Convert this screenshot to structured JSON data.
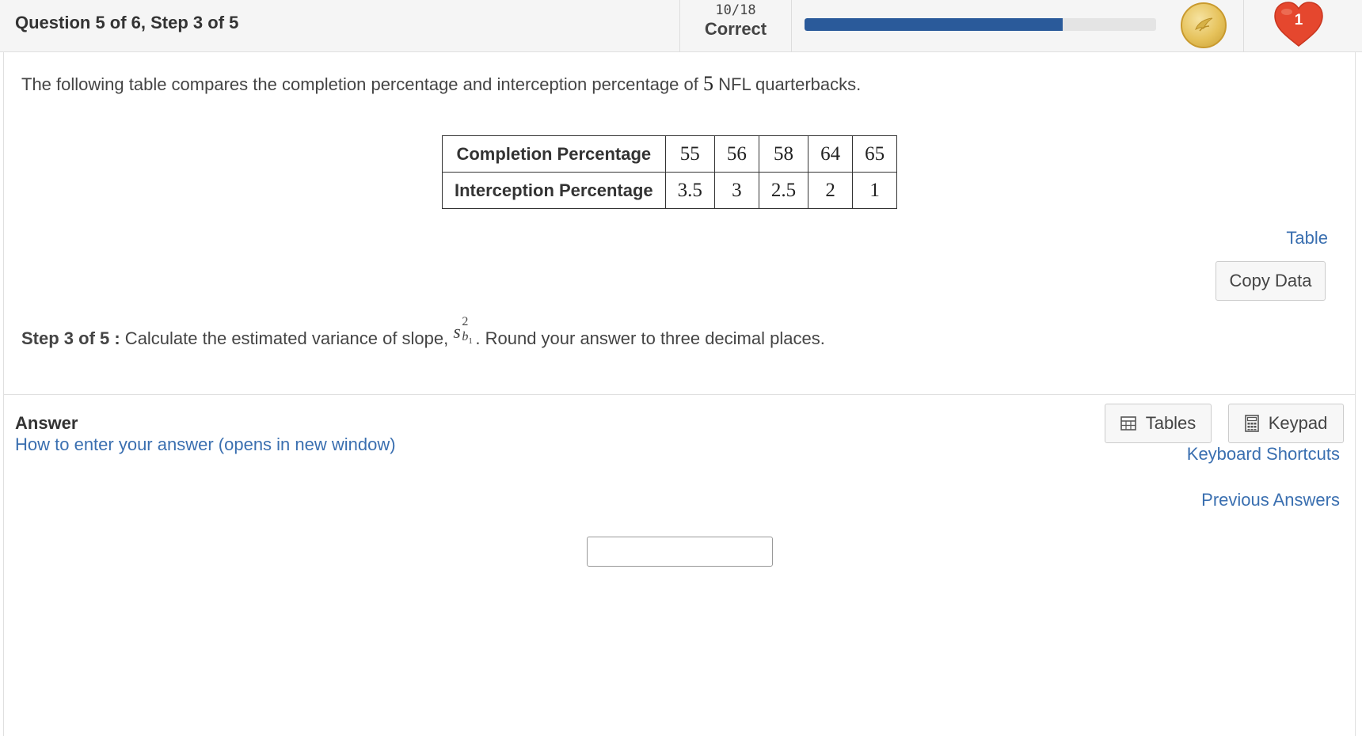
{
  "header": {
    "question_title": "Question 5 of 6, Step 3 of 5",
    "score_fraction": "10/18",
    "score_label": "Correct",
    "progress_fraction": 0.7333,
    "progress_color": "#2a5a9a",
    "coin_icon": "gold-coin-icon",
    "heart_icon": "heart-icon",
    "lives": "1"
  },
  "question": {
    "prompt_before": "The following table compares the completion percentage and interception percentage of ",
    "prompt_number": "5",
    "prompt_after": " NFL quarterbacks.",
    "table": {
      "rows": [
        {
          "header": "Completion Percentage",
          "values": [
            "55",
            "56",
            "58",
            "64",
            "65"
          ]
        },
        {
          "header": "Interception Percentage",
          "values": [
            "3.5",
            "3",
            "2.5",
            "2",
            "1"
          ]
        }
      ]
    },
    "table_link": "Table",
    "copy_data_label": "Copy Data",
    "step_label": "Step 3 of 5 :",
    "step_text_before": " Calculate the estimated variance of slope, ",
    "math_s": "s",
    "math_sup": "2",
    "math_sub": "b",
    "math_sub_sub": "1",
    "step_text_after": ". Round your answer to three decimal places."
  },
  "answer": {
    "title": "Answer",
    "howto_link": "How to enter your answer (opens in new window)",
    "tables_button": "Tables",
    "keypad_button": "Keypad",
    "keyboard_shortcuts_link": "Keyboard Shortcuts",
    "previous_answers_link": "Previous Answers",
    "input_value": ""
  }
}
